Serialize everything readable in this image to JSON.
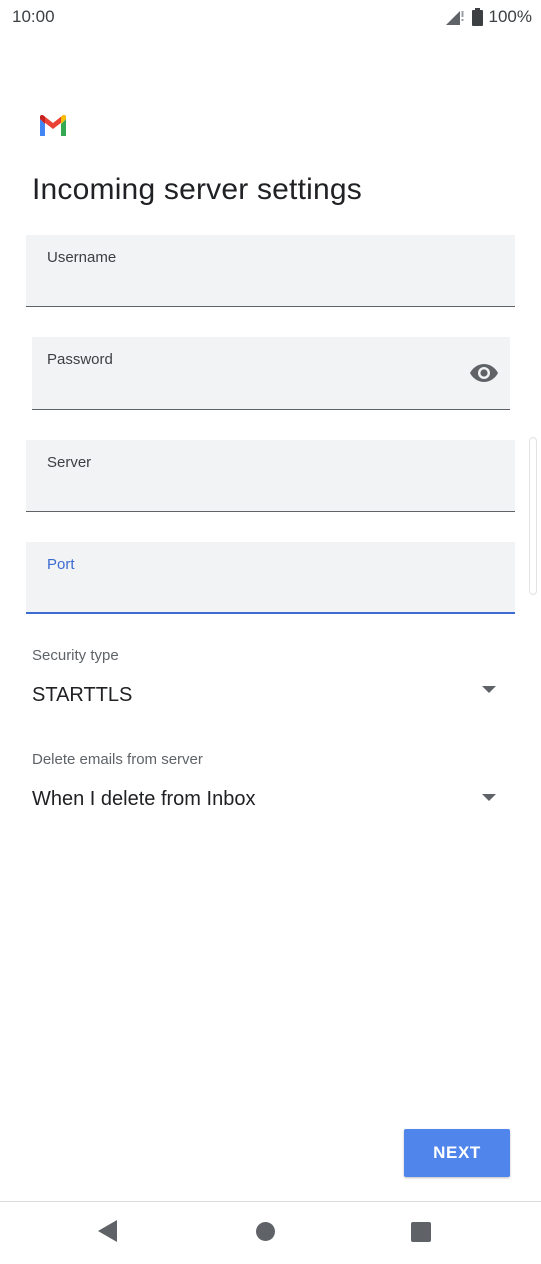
{
  "status_bar": {
    "time": "10:00",
    "battery": "100%",
    "icons": [
      "signal-icon",
      "battery-icon"
    ]
  },
  "app": {
    "logo": "gmail-logo-icon",
    "title": "Incoming server settings"
  },
  "form": {
    "username": {
      "label": "Username",
      "value": ""
    },
    "password": {
      "label": "Password",
      "value": "",
      "toggle_icon": "eye-icon"
    },
    "server": {
      "label": "Server",
      "value": ""
    },
    "port": {
      "label": "Port",
      "value": "",
      "focused": true
    },
    "security_type": {
      "label": "Security type",
      "selected": "STARTTLS"
    },
    "delete_emails": {
      "label": "Delete emails from server",
      "selected": "When I delete from Inbox"
    }
  },
  "actions": {
    "next_label": "NEXT"
  },
  "colors": {
    "accent": "#3c6bd1",
    "button": "#5086ec",
    "field_bg": "#f1f3f4"
  }
}
